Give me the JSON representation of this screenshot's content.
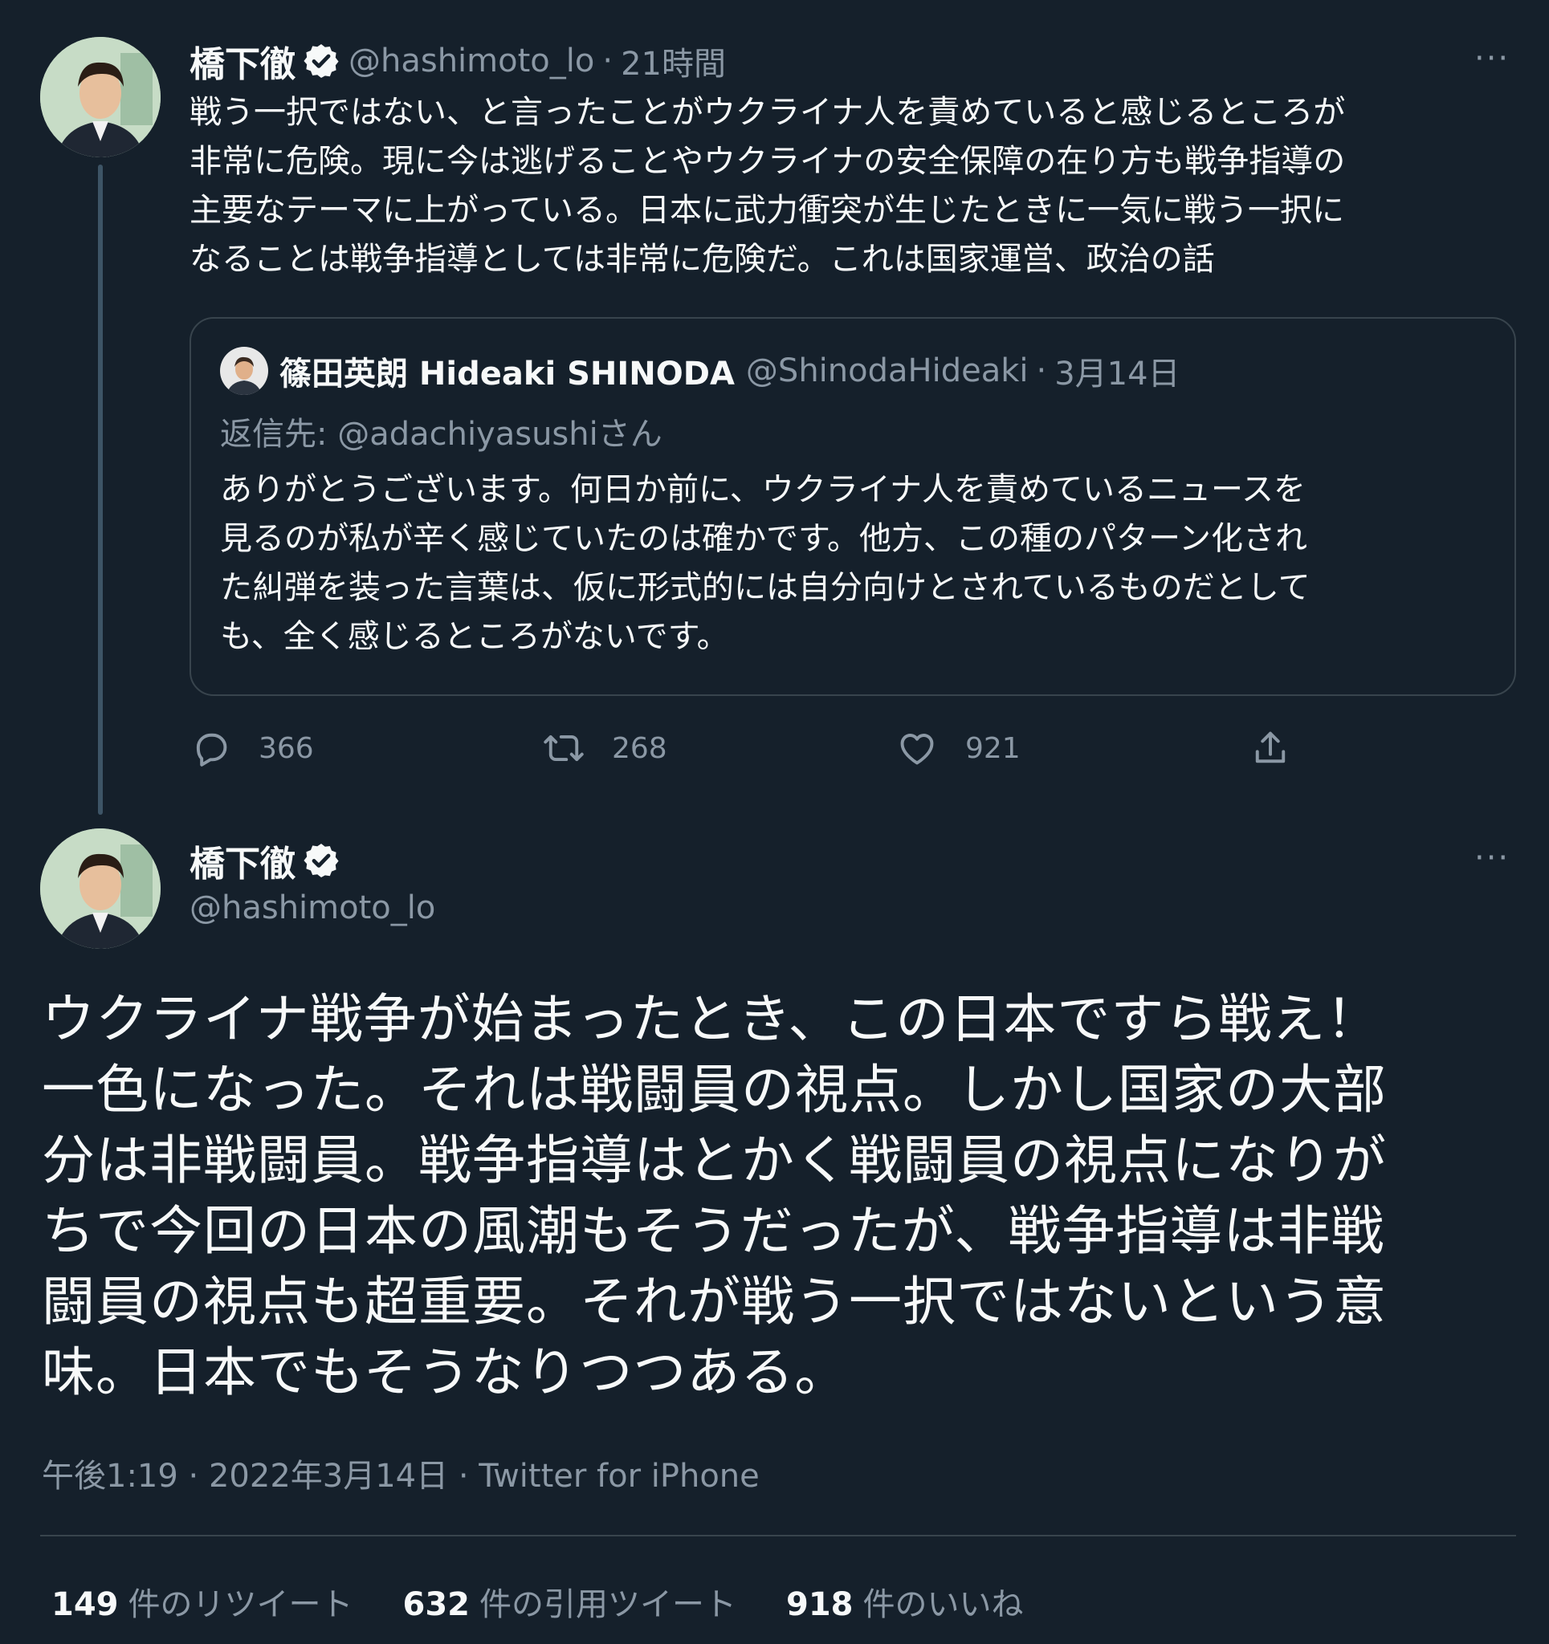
{
  "tweet1": {
    "display_name": "橋下徹",
    "handle": "@hashimoto_lo",
    "sep": "·",
    "time": "21時間",
    "more": "···",
    "text": "戦う一択ではない、と言ったことがウクライナ人を責めていると感じるところが\n非常に危険。現に今は逃げることやウクライナの安全保障の在り方も戦争指導の\n主要なテーマに上がっている。日本に武力衝突が生じたときに一気に戦う一択に\nなることは戦争指導としては非常に危険だ。これは国家運営、政治の話",
    "quote": {
      "display_name": "篠田英朗 Hideaki SHINODA",
      "handle": "@ShinodaHideaki",
      "sep": "·",
      "date": "3月14日",
      "reply_to": "返信先: @adachiyasushiさん",
      "text": "ありがとうございます。何日か前に、ウクライナ人を責めているニュースを\n見るのが私が辛く感じていたのは確かです。他方、この種のパターン化され\nた糾弾を装った言葉は、仮に形式的には自分向けとされているものだとして\nも、全く感じるところがないです。"
    },
    "actions": {
      "reply_count": "366",
      "retweet_count": "268",
      "like_count": "921"
    }
  },
  "tweet2": {
    "display_name": "橋下徹",
    "handle": "@hashimoto_lo",
    "more": "···",
    "text": "ウクライナ戦争が始まったとき、この日本ですら戦え！\n一色になった。それは戦闘員の視点。しかし国家の大部\n分は非戦闘員。戦争指導はとかく戦闘員の視点になりが\nちで今回の日本の風潮もそうだったが、戦争指導は非戦\n闘員の視点も超重要。それが戦う一択ではないという意\n味。日本でもそうなりつつある。",
    "meta": "午後1:19 · 2022年3月14日 · Twitter for iPhone",
    "stats": {
      "retweets_count": "149",
      "retweets_label": "件のリツイート",
      "quotes_count": "632",
      "quotes_label": "件の引用ツイート",
      "likes_count": "918",
      "likes_label": "件のいいね"
    }
  },
  "colors": {
    "background": "#15202b",
    "text": "#f7f9f9",
    "secondary": "#8b98a5",
    "border": "#38444d"
  }
}
